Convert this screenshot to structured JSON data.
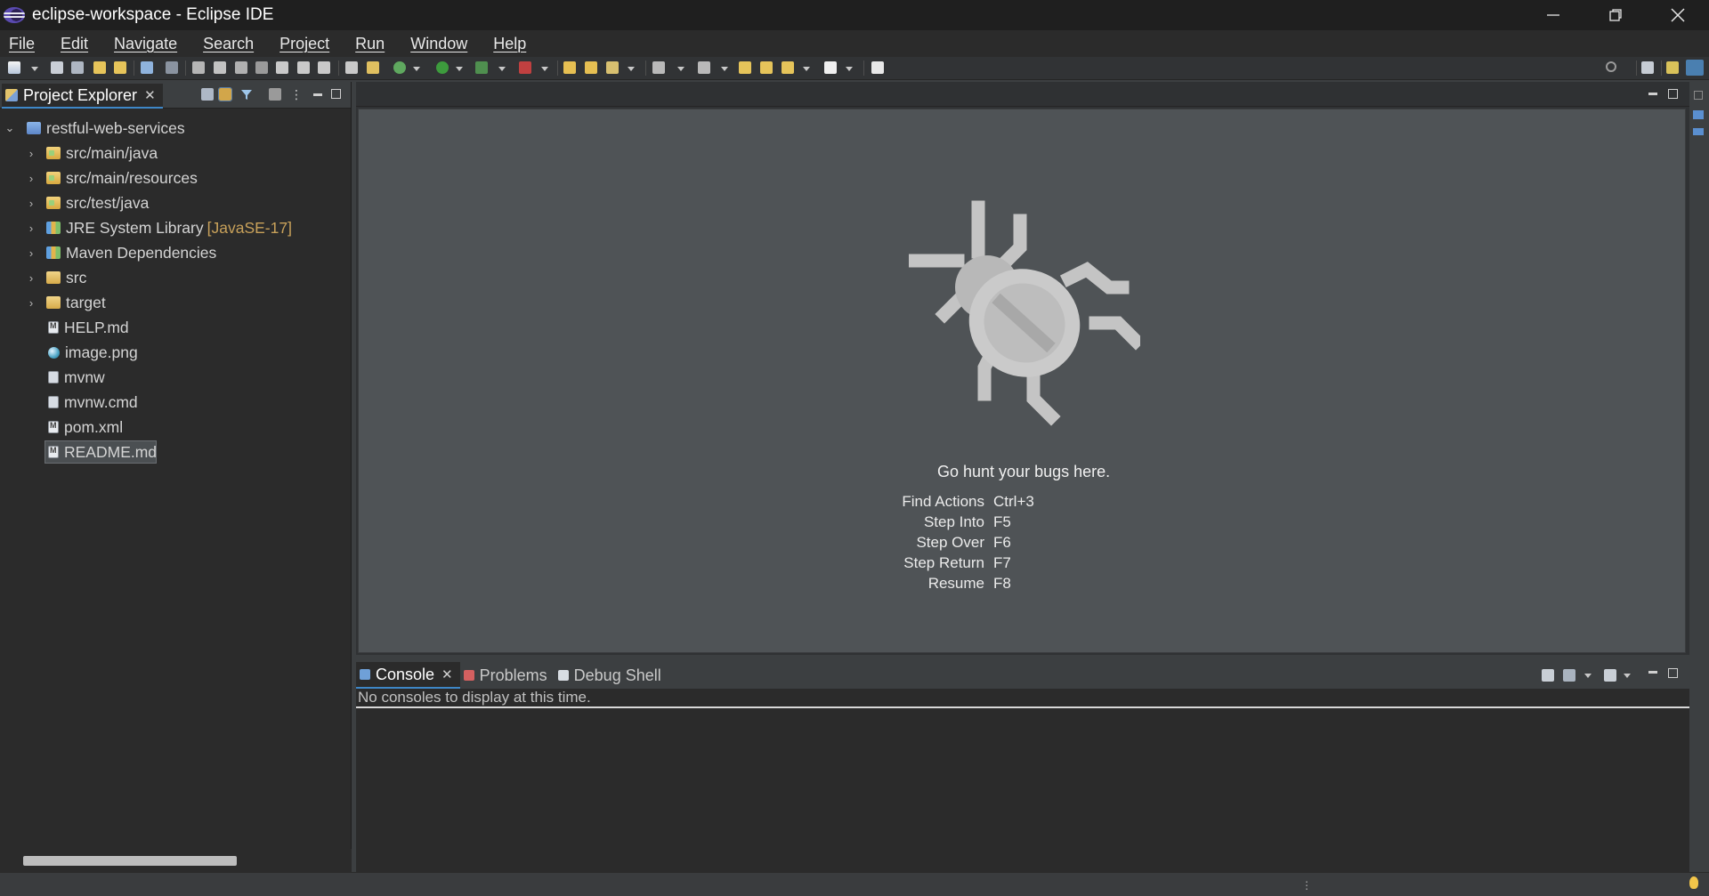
{
  "window": {
    "title": "eclipse-workspace - Eclipse IDE",
    "controls": [
      "minimize",
      "restore",
      "close"
    ]
  },
  "menubar": {
    "items": [
      "File",
      "Edit",
      "Navigate",
      "Search",
      "Project",
      "Run",
      "Window",
      "Help"
    ]
  },
  "explorer": {
    "tab_label": "Project Explorer",
    "tree": [
      {
        "label": "restful-web-services",
        "icon": "project-icon",
        "expanded": true
      },
      {
        "label": "src/main/java",
        "icon": "source-folder-icon"
      },
      {
        "label": "src/main/resources",
        "icon": "source-folder-icon"
      },
      {
        "label": "src/test/java",
        "icon": "source-folder-icon"
      },
      {
        "label": "JRE System Library",
        "decoration": "[JavaSE-17]",
        "icon": "library-icon"
      },
      {
        "label": "Maven Dependencies",
        "icon": "library-icon"
      },
      {
        "label": "src",
        "icon": "folder-icon"
      },
      {
        "label": "target",
        "icon": "folder-icon"
      },
      {
        "label": "HELP.md",
        "icon": "markdown-file-icon"
      },
      {
        "label": "image.png",
        "icon": "image-file-icon"
      },
      {
        "label": "mvnw",
        "icon": "file-icon"
      },
      {
        "label": "mvnw.cmd",
        "icon": "file-icon"
      },
      {
        "label": "pom.xml",
        "icon": "maven-pom-icon"
      },
      {
        "label": "README.md",
        "icon": "markdown-file-icon",
        "selected": true
      }
    ]
  },
  "editor": {
    "empty_title": "Go hunt your bugs here.",
    "shortcuts": [
      {
        "name": "Find Actions",
        "key": "Ctrl+3"
      },
      {
        "name": "Step Into",
        "key": "F5"
      },
      {
        "name": "Step Over",
        "key": "F6"
      },
      {
        "name": "Step Return",
        "key": "F7"
      },
      {
        "name": "Resume",
        "key": "F8"
      }
    ]
  },
  "console": {
    "tabs": [
      {
        "label": "Console",
        "active": true
      },
      {
        "label": "Problems",
        "active": false
      },
      {
        "label": "Debug Shell",
        "active": false
      }
    ],
    "message": "No consoles to display at this time."
  },
  "colors": {
    "accent": "#3e87c7",
    "editor_bg": "#4f5356",
    "decoration": "#c8a15a"
  }
}
